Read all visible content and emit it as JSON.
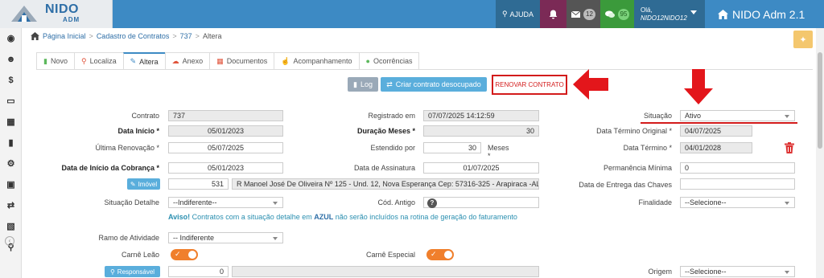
{
  "app": {
    "brand_name": "NIDO",
    "brand_sub": "ADM",
    "title": "NIDO Adm 2.1"
  },
  "topbar": {
    "help_label": "AJUDA",
    "mail_count": "12",
    "chat_count": "95",
    "greeting": "Olá,",
    "username": "NIDO12NIDO12"
  },
  "breadcrumb": {
    "home": "Página Inicial",
    "section": "Cadastro de Contratos",
    "id": "737",
    "current": "Altera"
  },
  "tabs": [
    {
      "label": "Novo",
      "icon": "file-icon",
      "color": "#5cb85c"
    },
    {
      "label": "Localiza",
      "icon": "search-icon",
      "color": "#e0533a"
    },
    {
      "label": "Altera",
      "icon": "pencil-icon",
      "color": "#3d8ac4"
    },
    {
      "label": "Anexo",
      "icon": "cloud-upload-icon",
      "color": "#e0533a"
    },
    {
      "label": "Documentos",
      "icon": "book-icon",
      "color": "#e0533a"
    },
    {
      "label": "Acompanhamento",
      "icon": "thumbs-up-icon",
      "color": "#3d8ac4"
    },
    {
      "label": "Ocorrências",
      "icon": "comments-icon",
      "color": "#5cb85c"
    }
  ],
  "actions": {
    "log": "Log",
    "criar": "Criar contrato desocupado",
    "renovar": "RENOVAR CONTRATO"
  },
  "form": {
    "contrato_label": "Contrato",
    "contrato": "737",
    "registrado_label": "Registrado em",
    "registrado": "07/07/2025 14:12:59",
    "situacao_label": "Situação",
    "situacao": "Ativo",
    "data_inicio_label": "Data Início *",
    "data_inicio": "05/01/2023",
    "duracao_label": "Duração Meses *",
    "duracao": "30",
    "termino_original_label": "Data Término Original *",
    "termino_original": "04/07/2025",
    "ultima_renov_label": "Última Renovação *",
    "ultima_renov": "05/07/2025",
    "estendido_label": "Estendido por",
    "estendido": "30",
    "meses_label": "Meses *",
    "data_termino_label": "Data Término *",
    "data_termino": "04/01/2028",
    "inicio_cobranca_label": "Data de Início da Cobrança *",
    "inicio_cobranca": "05/01/2023",
    "assinatura_label": "Data de Assinatura",
    "assinatura": "01/07/2025",
    "permanencia_label": "Permanência Mínima",
    "permanencia": "0",
    "imovel_button": "Imóvel",
    "imovel_code": "531",
    "imovel_address": "R Manoel José De Oliveira Nº 125  - Und. 12, Nova Esperança Cep: 57316-325 - Arapiraca -AL",
    "entrega_chaves_label": "Data de Entrega das Chaves",
    "situacao_detalhe_label": "Situação Detalhe",
    "situacao_detalhe": "--Indiferente--",
    "cod_antigo_label": "Cód. Antigo",
    "finalidade_label": "Finalidade",
    "finalidade": "--Selecione--",
    "aviso_prefix": "Aviso!",
    "aviso_mid": " Contratos com a situação detalhe em ",
    "aviso_azul": "AZUL",
    "aviso_suffix": " não serão incluídos na rotina de geração do faturamento",
    "ramo_label": "Ramo de Atividade",
    "ramo": "-- Indiferente",
    "carne_leao_label": "Carnê Leão",
    "carne_especial_label": "Carnê Especial",
    "responsavel_button": "Responsável",
    "responsavel_code": "0",
    "origem_label": "Origem",
    "origem": "--Selecione--"
  },
  "colors": {
    "topbar": "#3d8ac4",
    "accent_red": "#d31b1b",
    "toggle_on": "#f07f2c"
  }
}
